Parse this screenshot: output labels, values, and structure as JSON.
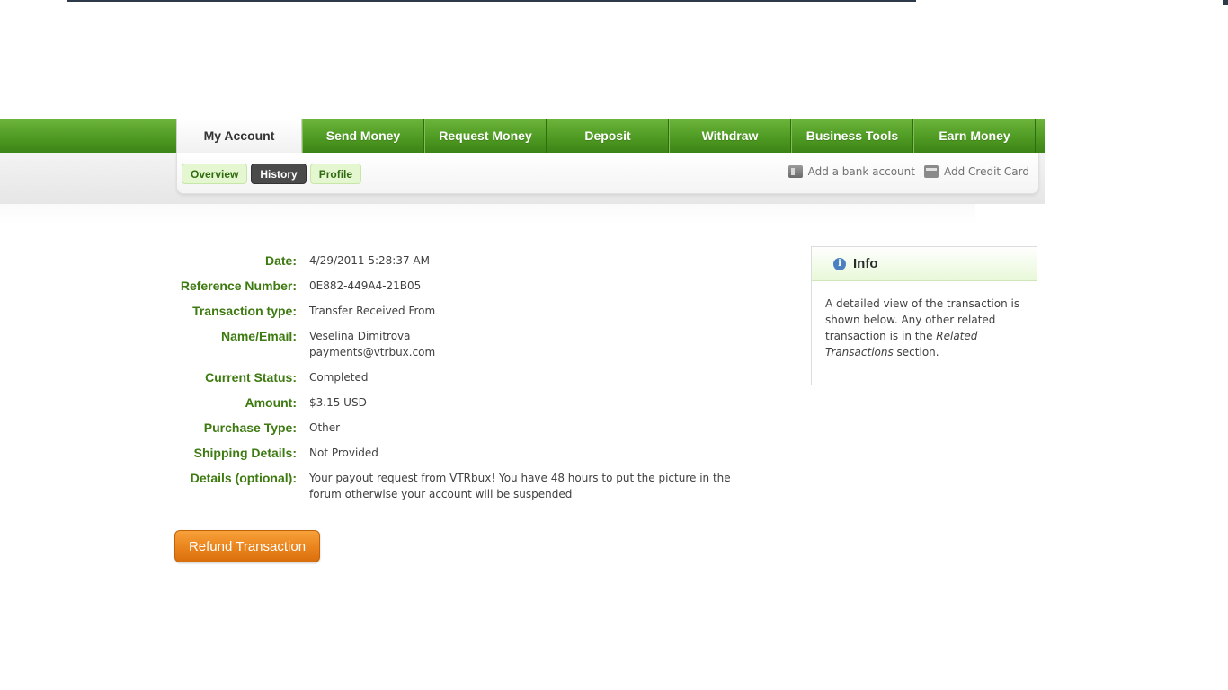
{
  "nav": {
    "tabs": [
      {
        "label": "My Account"
      },
      {
        "label": "Send Money"
      },
      {
        "label": "Request Money"
      },
      {
        "label": "Deposit"
      },
      {
        "label": "Withdraw"
      },
      {
        "label": "Business Tools"
      },
      {
        "label": "Earn Money"
      }
    ],
    "active_tab": "My Account"
  },
  "subnav": {
    "tabs": [
      {
        "label": "Overview"
      },
      {
        "label": "History"
      },
      {
        "label": "Profile"
      }
    ],
    "active_tab": "History",
    "links": [
      {
        "label": "Add a bank account",
        "icon": "bank-icon"
      },
      {
        "label": "Add Credit Card",
        "icon": "credit-card-icon"
      }
    ]
  },
  "transaction": {
    "date_label": "Date:",
    "date": "4/29/2011 5:28:37 AM",
    "reference_label": "Reference Number:",
    "reference": "0E882-449A4-21B05",
    "type_label": "Transaction type:",
    "type": "Transfer Received From",
    "name_label": "Name/Email:",
    "name": "Veselina Dimitrova",
    "email": "payments@vtrbux.com",
    "status_label": "Current Status:",
    "status": "Completed",
    "amount_label": "Amount:",
    "amount": "$3.15 USD",
    "purchase_label": "Purchase Type:",
    "purchase": "Other",
    "shipping_label": "Shipping Details:",
    "shipping": "Not Provided",
    "details_label": "Details (optional):",
    "details": "Your payout request from VTRbux! You have 48 hours to put the picture in the forum otherwise your account will be suspended"
  },
  "actions": {
    "refund_label": "Refund Transaction"
  },
  "info": {
    "title": "Info",
    "icon": "info-icon",
    "text_1": "A detailed view of the transaction is shown below. Any other related transaction is in the ",
    "text_em": "Related Transactions",
    "text_2": " section."
  },
  "colors": {
    "nav_green": "#4e9a22",
    "label_green": "#3d7a10",
    "button_orange": "#e8811a"
  }
}
